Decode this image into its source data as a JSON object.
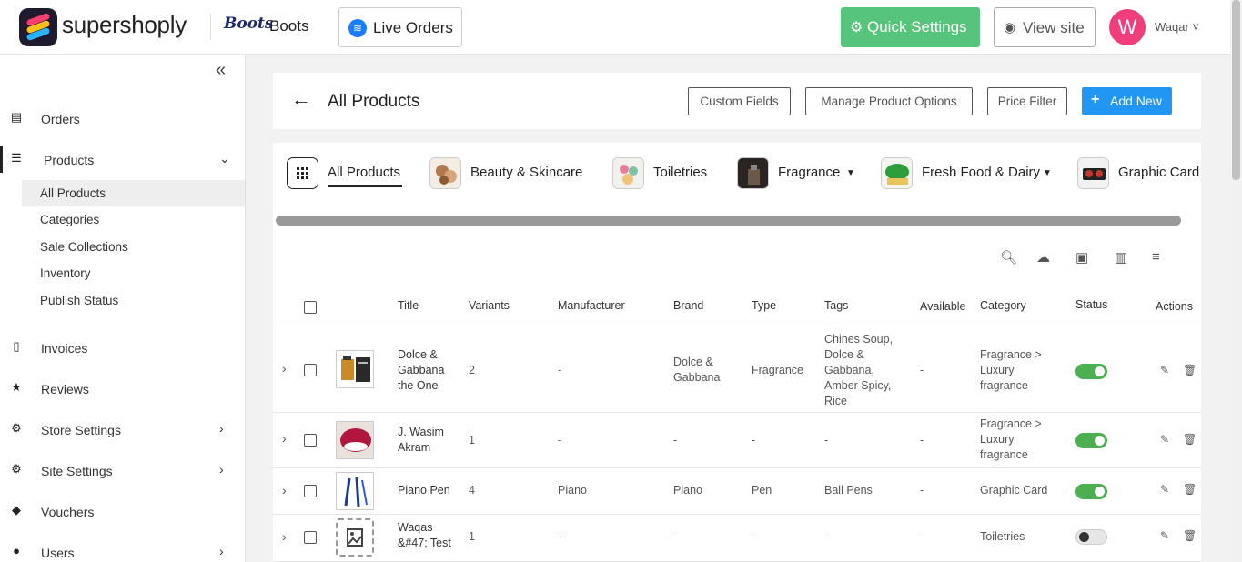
{
  "header": {
    "brand_name": "supershoply",
    "store_logo": "Boots",
    "store_name": "Boots",
    "live_orders_label": "Live Orders",
    "quick_settings_label": "Quick Settings",
    "view_site_label": "View site",
    "avatar_initial": "W",
    "user_name": "Waqar ˅"
  },
  "sidebar": {
    "collapse_icon": "double-chevron-left-icon",
    "items": [
      {
        "label": "Orders",
        "icon": "list-icon"
      },
      {
        "label": "Products",
        "icon": "bullet-list-icon",
        "expanded": true
      },
      {
        "label": "Invoices",
        "icon": "document-icon"
      },
      {
        "label": "Reviews",
        "icon": "star-icon"
      },
      {
        "label": "Store Settings",
        "icon": "gear-icon"
      },
      {
        "label": "Site Settings",
        "icon": "gear-icon"
      },
      {
        "label": "Vouchers",
        "icon": "tag-icon"
      },
      {
        "label": "Users",
        "icon": "user-icon"
      }
    ],
    "products_sub": [
      {
        "label": "All Products",
        "active": true
      },
      {
        "label": "Categories"
      },
      {
        "label": "Sale Collections"
      },
      {
        "label": "Inventory"
      },
      {
        "label": "Publish Status"
      }
    ]
  },
  "page": {
    "title": "All Products",
    "buttons": {
      "custom_fields": "Custom Fields",
      "manage_options": "Manage Product Options",
      "price_filter": "Price Filter",
      "add_new": "Add New"
    }
  },
  "category_tabs": [
    {
      "label": "All Products",
      "active": true
    },
    {
      "label": "Beauty & Skincare"
    },
    {
      "label": "Toiletries"
    },
    {
      "label": "Fragrance",
      "dropdown": true
    },
    {
      "label": "Fresh Food & Dairy",
      "dropdown": true
    },
    {
      "label": "Graphic Card"
    }
  ],
  "table": {
    "columns": [
      "Title",
      "Variants",
      "Manufacturer",
      "Brand",
      "Type",
      "Tags",
      "Available",
      "Category",
      "Status",
      "Actions"
    ],
    "rows": [
      {
        "title": "Dolce & Gabbana the One",
        "variants": "2",
        "manufacturer": "-",
        "brand": "Dolce & Gabbana",
        "type": "Fragrance",
        "tags": "Chines Soup, Dolce & Gabbana, Amber Spicy, Rice",
        "available": "-",
        "category": "Fragrance > Luxury fragrance",
        "status": "on"
      },
      {
        "title": "J. Wasim Akram",
        "variants": "1",
        "manufacturer": "-",
        "brand": "-",
        "type": "-",
        "tags": "-",
        "available": "-",
        "category": "Fragrance > Luxury fragrance",
        "status": "on"
      },
      {
        "title": "Piano Pen",
        "variants": "4",
        "manufacturer": "Piano",
        "brand": "Piano",
        "type": "Pen",
        "tags": "Ball Pens",
        "available": "-",
        "category": "Graphic Card",
        "status": "on"
      },
      {
        "title": "Waqas &#47; Test",
        "variants": "1",
        "manufacturer": "-",
        "brand": "-",
        "type": "-",
        "tags": "-",
        "available": "-",
        "category": "Toiletries",
        "status": "off"
      }
    ]
  },
  "colors": {
    "quick_settings": "#56c47a",
    "add_new": "#2196f3",
    "avatar": "#f03e7c",
    "toggle_on": "#4caf50"
  }
}
